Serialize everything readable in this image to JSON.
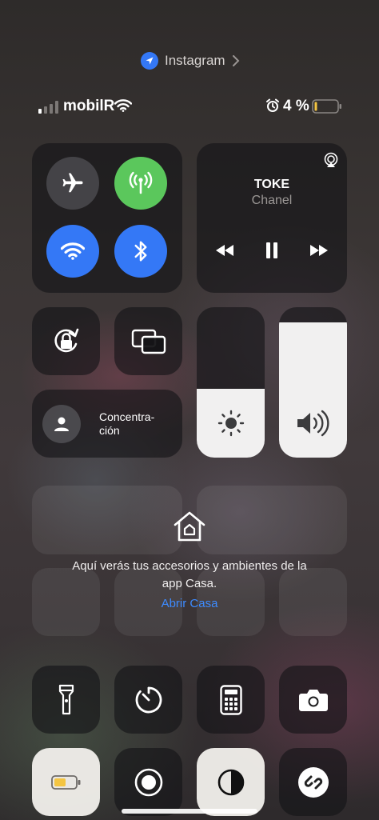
{
  "top_app": {
    "name": "Instagram"
  },
  "status_bar": {
    "carrier": "mobilR",
    "battery_percent": "4 %",
    "signal_bars": 1
  },
  "connectivity": {
    "airplane_on": false,
    "cellular_on": true,
    "wifi_on": true,
    "bluetooth_on": true
  },
  "now_playing": {
    "title": "TOKE",
    "artist": "Chanel"
  },
  "focus": {
    "label": "Concentra-\nción"
  },
  "sliders": {
    "brightness_level": 0.46,
    "volume_level": 0.9
  },
  "home": {
    "message": "Aquí verás tus accesorios y ambientes de la app Casa.",
    "link": "Abrir Casa"
  },
  "colors": {
    "accent_blue": "#3478f6",
    "accent_green": "#5bc75c",
    "link_blue": "#3d8bff",
    "battery_low": "#f4c542"
  }
}
